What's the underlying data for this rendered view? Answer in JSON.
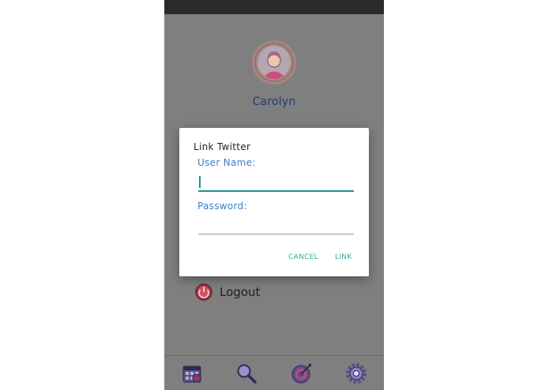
{
  "profile": {
    "name": "Carolyn"
  },
  "menu": {
    "logout_label": "Logout"
  },
  "dialog": {
    "title": "Link Twitter",
    "username_label": "User Name:",
    "username_value": "",
    "password_label": "Password:",
    "password_value": "",
    "cancel_label": "CANCEL",
    "link_label": "LINK"
  },
  "nav": {
    "icons": [
      "calendar-icon",
      "search-icon",
      "target-icon",
      "gear-icon"
    ]
  },
  "colors": {
    "scrim": "#7f7f7f",
    "status_bar": "#2a2a2a",
    "accent_teal": "#1a948a",
    "label_blue": "#3d7fc4",
    "profile_name": "#1f3b78",
    "button_text": "#3aa89a"
  }
}
